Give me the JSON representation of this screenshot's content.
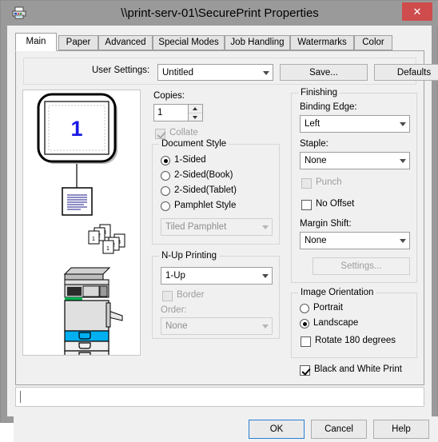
{
  "window": {
    "title": "\\\\print-serv-01\\SecurePrint Properties",
    "icon": "printer-icon",
    "close_label": "✕"
  },
  "tabs": [
    {
      "label": "Main",
      "active": true
    },
    {
      "label": "Paper",
      "active": false
    },
    {
      "label": "Advanced",
      "active": false
    },
    {
      "label": "Special Modes",
      "active": false
    },
    {
      "label": "Job Handling",
      "active": false
    },
    {
      "label": "Watermarks",
      "active": false
    },
    {
      "label": "Color",
      "active": false
    }
  ],
  "user_settings": {
    "label": "User Settings:",
    "value": "Untitled",
    "save_label": "Save...",
    "defaults_label": "Defaults"
  },
  "preview": {
    "page_number": "1",
    "page_numbers": [
      "1",
      "2",
      "3"
    ],
    "accent_color": "#1a1ae6",
    "tray_highlight_color": "#00b0f0"
  },
  "copies": {
    "label": "Copies:",
    "value": "1",
    "collate_label": "Collate",
    "collate_checked": true,
    "collate_enabled": false
  },
  "document_style": {
    "legend": "Document Style",
    "options": [
      {
        "label": "1-Sided",
        "selected": true
      },
      {
        "label": "2-Sided(Book)",
        "selected": false
      },
      {
        "label": "2-Sided(Tablet)",
        "selected": false
      },
      {
        "label": "Pamphlet Style",
        "selected": false
      }
    ],
    "pamphlet_value": "Tiled Pamphlet",
    "pamphlet_enabled": false
  },
  "nup_printing": {
    "legend": "N-Up Printing",
    "value": "1-Up",
    "border_label": "Border",
    "border_checked": false,
    "border_enabled": false,
    "order_label": "Order:",
    "order_value": "None",
    "order_enabled": false
  },
  "finishing": {
    "legend": "Finishing",
    "binding_edge_label": "Binding Edge:",
    "binding_edge_value": "Left",
    "staple_label": "Staple:",
    "staple_value": "None",
    "punch_label": "Punch",
    "punch_checked": false,
    "punch_enabled": false,
    "no_offset_label": "No Offset",
    "no_offset_checked": false,
    "margin_shift_label": "Margin Shift:",
    "margin_shift_value": "None",
    "settings_label": "Settings...",
    "settings_enabled": false
  },
  "image_orientation": {
    "legend": "Image Orientation",
    "options": [
      {
        "label": "Portrait",
        "selected": false
      },
      {
        "label": "Landscape",
        "selected": true
      }
    ],
    "rotate_label": "Rotate 180 degrees",
    "rotate_checked": false
  },
  "black_and_white": {
    "label": "Black and White Print",
    "checked": true
  },
  "status_bar": {
    "text": ""
  },
  "footer": {
    "ok_label": "OK",
    "cancel_label": "Cancel",
    "help_label": "Help"
  }
}
